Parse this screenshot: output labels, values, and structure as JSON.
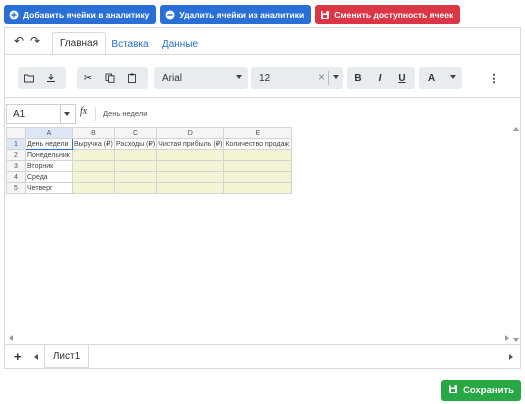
{
  "actions": {
    "add_label": "Добавить ячейки в аналитику",
    "remove_label": "Удалить ячейки из аналитики",
    "toggle_label": "Сменить доступность ячеек"
  },
  "tabs": [
    {
      "label": "Главная",
      "active": true
    },
    {
      "label": "Вставка",
      "active": false
    },
    {
      "label": "Данные",
      "active": false
    }
  ],
  "toolbar": {
    "font": "Arial",
    "size": "12",
    "bold": "B",
    "italic": "I",
    "underline": "U",
    "color": "A"
  },
  "formula": {
    "cell_ref": "A1",
    "fx": "fx",
    "value": "День недели"
  },
  "sheet": {
    "columns": [
      "A",
      "B",
      "C",
      "D",
      "E"
    ],
    "rows": [
      {
        "num": "1",
        "cells": [
          "День недели",
          "Выручка (₽)",
          "Расходы (₽)",
          "Чистая прибыль (₽)",
          "Количество продаж"
        ]
      },
      {
        "num": "2",
        "cells": [
          "Понедельник",
          "",
          "",
          "",
          ""
        ]
      },
      {
        "num": "3",
        "cells": [
          "Вторник",
          "",
          "",
          "",
          ""
        ]
      },
      {
        "num": "4",
        "cells": [
          "Среда",
          "",
          "",
          "",
          ""
        ]
      },
      {
        "num": "5",
        "cells": [
          "Четверг",
          "",
          "",
          "",
          ""
        ]
      }
    ]
  },
  "sheet_tab": "Лист1",
  "save_label": "Сохранить",
  "colors": {
    "primary": "#2a6fd6",
    "danger": "#dc3545",
    "success": "#28a745",
    "highlight": "#f2f4d4"
  }
}
